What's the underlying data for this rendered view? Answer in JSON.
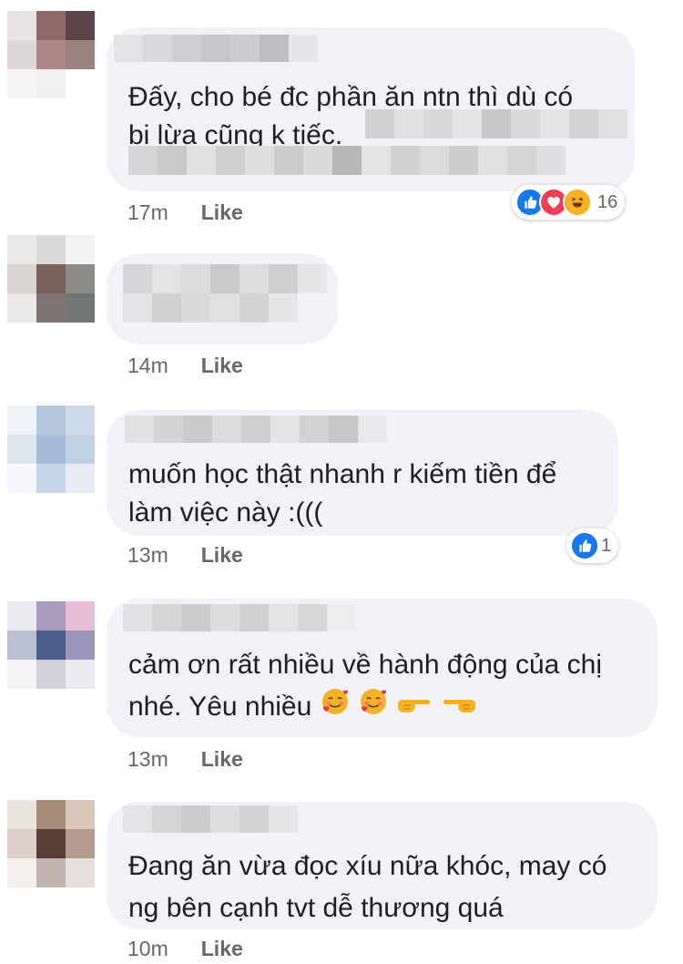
{
  "comments": [
    {
      "lines": [
        "Đấy, cho bé đc phần ăn ntn thì dù có",
        "bị lừa cũng k tiếc."
      ],
      "time": "17m",
      "like": "Like",
      "reactions": {
        "types": [
          "like-icon",
          "love-icon",
          "haha-icon"
        ],
        "count": "16"
      }
    },
    {
      "lines": [],
      "time": "14m",
      "like": "Like"
    },
    {
      "lines": [
        "muốn học thật nhanh r kiếm tiền để",
        "làm việc này :((("
      ],
      "time": "13m",
      "like": "Like",
      "reactions": {
        "types": [
          "like-icon"
        ],
        "count": "1"
      }
    },
    {
      "lines": [
        "cảm ơn rất nhiều về hành động của chị",
        "nhé. Yêu nhiều"
      ],
      "time": "13m",
      "like": "Like",
      "emojis": [
        "smiling-face-with-hearts-icon",
        "smiling-face-with-hearts-icon",
        "backhand-index-pointing-right-icon",
        "backhand-index-pointing-left-icon"
      ]
    },
    {
      "lines": [
        "Đang ăn vừa đọc xíu nữa khóc, may có",
        "ng bên cạnh tvt dễ thương quá"
      ],
      "time": "10m",
      "like": "Like"
    }
  ],
  "colors": {
    "bubble": "#f0f2f5",
    "like_blue": "#1877f2",
    "love_red": "#f33e58",
    "haha_yellow": "#f7b125",
    "meta_gray": "#65676b"
  }
}
